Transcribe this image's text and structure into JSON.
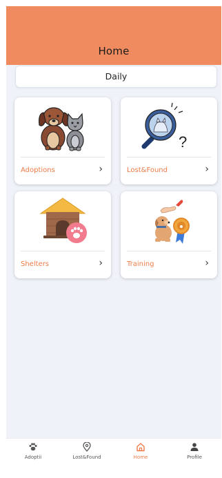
{
  "header": {
    "title": "Home"
  },
  "daily": {
    "label": "Daily"
  },
  "cards": [
    {
      "label": "Adoptions",
      "icon": "dog-and-cat-icon"
    },
    {
      "label": "Lost&Found",
      "icon": "magnifier-pets-icon"
    },
    {
      "label": "Shelters",
      "icon": "doghouse-icon"
    },
    {
      "label": "Training",
      "icon": "dog-training-icon"
    }
  ],
  "chevron": "›",
  "nav": [
    {
      "label": "Adoptii",
      "icon": "paw-icon",
      "active": false
    },
    {
      "label": "Lost&Found",
      "icon": "location-pin-icon",
      "active": false
    },
    {
      "label": "Home",
      "icon": "home-icon",
      "active": true
    },
    {
      "label": "Profile",
      "icon": "person-icon",
      "active": false
    }
  ],
  "colors": {
    "accent": "#ef8b5e",
    "accent_text": "#ec7b48",
    "background": "#eff2f9"
  }
}
